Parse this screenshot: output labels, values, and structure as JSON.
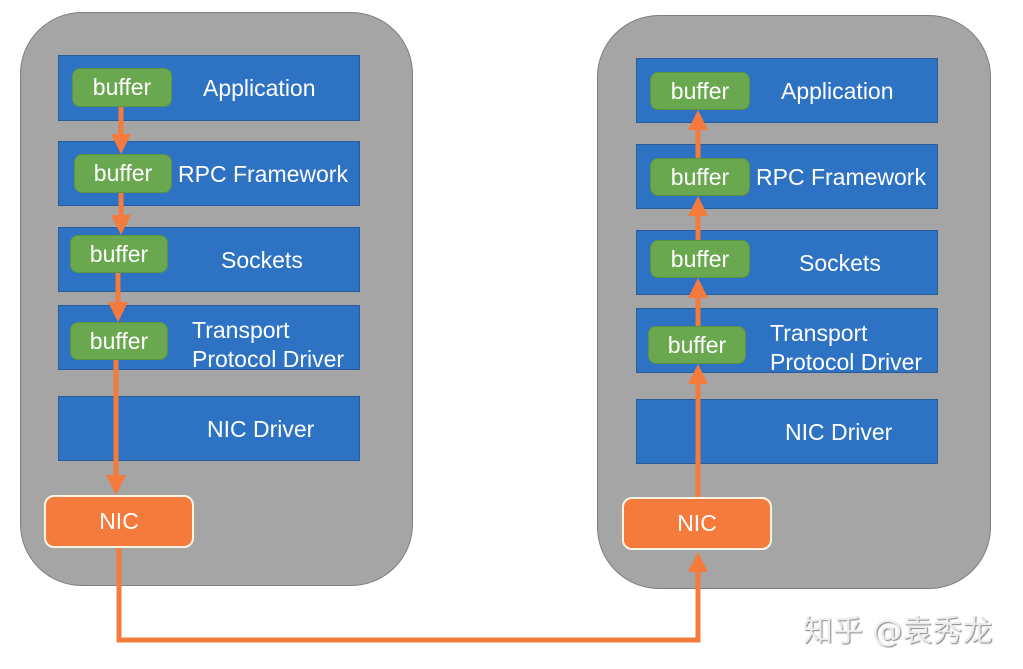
{
  "buffer_label": "buffer",
  "layers": {
    "application": "Application",
    "rpc": "RPC Framework",
    "sockets": "Sockets",
    "transport_line1": "Transport",
    "transport_line2": "Protocol Driver",
    "nic_driver": "NIC Driver"
  },
  "nic_label": "NIC",
  "watermark": "知乎 @袁秀龙",
  "colors": {
    "host": "#a5a5a5",
    "layer": "#2e72c4",
    "buffer": "#6aa84f",
    "nic": "#f47b3b",
    "arrow": "#f47b3b"
  }
}
